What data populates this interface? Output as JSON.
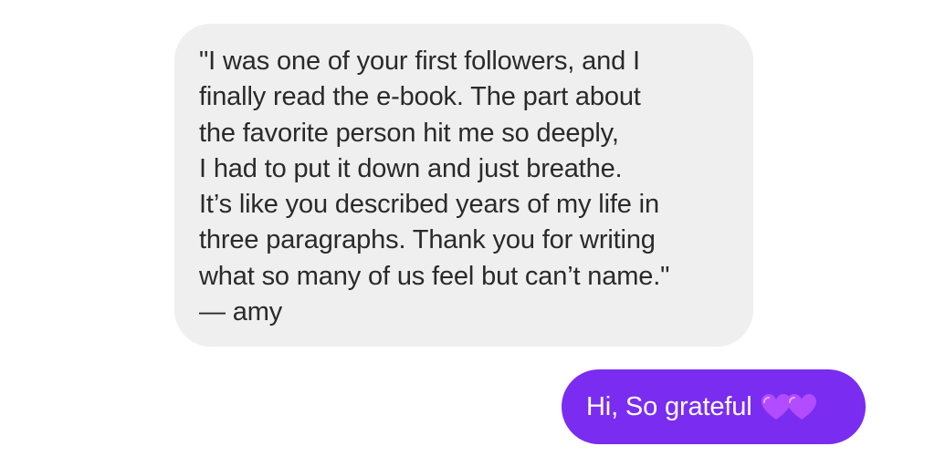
{
  "conversation": {
    "incoming_message": {
      "lines": [
        "\"I was one of your first followers, and I",
        "finally read the e-book. The part about",
        "the favorite person hit me so deeply,",
        "I had to put it down and just breathe.",
        "It’s like you described years of my life in",
        "three paragraphs. Thank you for writing",
        "what so many of us feel but can’t name.\"",
        "— amy"
      ]
    },
    "outgoing_message": {
      "text": "Hi, So grateful",
      "emoji": [
        "purple-heart-icon",
        "purple-heart-icon"
      ]
    }
  },
  "colors": {
    "incoming_bubble": "#efefef",
    "outgoing_bubble": "#7a2cf0",
    "heart": "#b24cff"
  }
}
